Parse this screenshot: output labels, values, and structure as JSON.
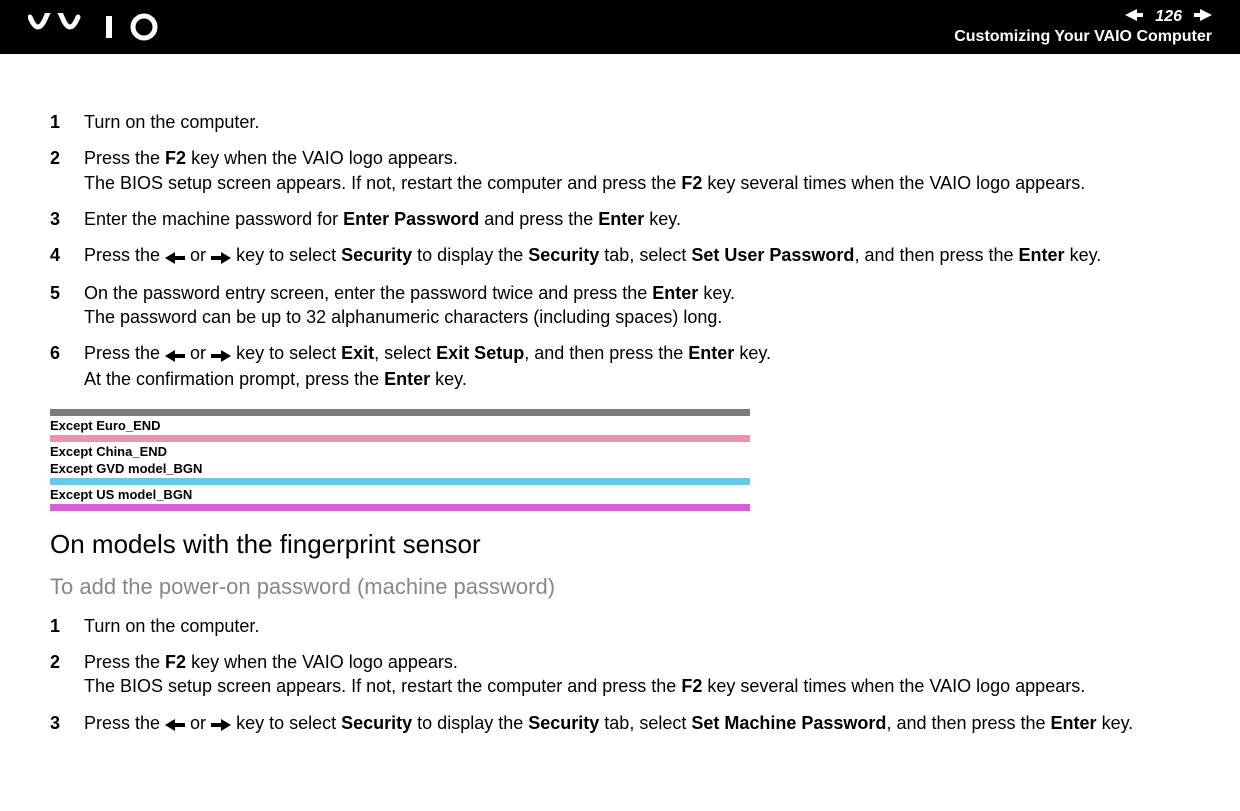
{
  "header": {
    "page_number": "126",
    "section_title": "Customizing Your VAIO Computer"
  },
  "list1": [
    {
      "num": "1",
      "segments": [
        {
          "t": "Turn on the computer."
        }
      ]
    },
    {
      "num": "2",
      "segments": [
        {
          "t": "Press the "
        },
        {
          "t": "F2",
          "b": true
        },
        {
          "t": " key when the VAIO logo appears."
        },
        {
          "t": "\n"
        },
        {
          "t": "The BIOS setup screen appears. If not, restart the computer and press the "
        },
        {
          "t": "F2",
          "b": true
        },
        {
          "t": " key several times when the VAIO logo appears."
        }
      ]
    },
    {
      "num": "3",
      "segments": [
        {
          "t": "Enter the machine password for "
        },
        {
          "t": "Enter Password",
          "b": true
        },
        {
          "t": " and press the "
        },
        {
          "t": "Enter",
          "b": true
        },
        {
          "t": " key."
        }
      ]
    },
    {
      "num": "4",
      "segments": [
        {
          "t": "Press the "
        },
        {
          "icon": "left"
        },
        {
          "t": " or "
        },
        {
          "icon": "right"
        },
        {
          "t": " key to select "
        },
        {
          "t": "Security",
          "b": true
        },
        {
          "t": " to display the "
        },
        {
          "t": "Security",
          "b": true
        },
        {
          "t": " tab, select "
        },
        {
          "t": "Set User Password",
          "b": true
        },
        {
          "t": ", and then press the "
        },
        {
          "t": "Enter",
          "b": true
        },
        {
          "t": " key."
        }
      ]
    },
    {
      "num": "5",
      "segments": [
        {
          "t": "On the password entry screen, enter the password twice and press the "
        },
        {
          "t": "Enter",
          "b": true
        },
        {
          "t": " key."
        },
        {
          "t": "\n"
        },
        {
          "t": "The password can be up to 32 alphanumeric characters (including spaces) long."
        }
      ]
    },
    {
      "num": "6",
      "segments": [
        {
          "t": "Press the "
        },
        {
          "icon": "left"
        },
        {
          "t": " or "
        },
        {
          "icon": "right"
        },
        {
          "t": " key to select "
        },
        {
          "t": "Exit",
          "b": true
        },
        {
          "t": ", select "
        },
        {
          "t": "Exit Setup",
          "b": true
        },
        {
          "t": ", and then press the "
        },
        {
          "t": "Enter",
          "b": true
        },
        {
          "t": " key."
        },
        {
          "t": "\n"
        },
        {
          "t": "At the confirmation prompt, press the "
        },
        {
          "t": "Enter",
          "b": true
        },
        {
          "t": " key."
        }
      ]
    }
  ],
  "markers": [
    {
      "color": "#7a7a7a",
      "label": "Except Euro_END"
    },
    {
      "color": "#f08fb1",
      "label": "Except China_END"
    },
    {
      "noBar": true,
      "label": "Except GVD model_BGN"
    },
    {
      "color": "#6bc6e8",
      "label": "Except US model_BGN"
    },
    {
      "color": "#d65fd6",
      "label": ""
    }
  ],
  "subheading": "On models with the fingerprint sensor",
  "subsubheading": "To add the power-on password (machine password)",
  "list2": [
    {
      "num": "1",
      "segments": [
        {
          "t": "Turn on the computer."
        }
      ]
    },
    {
      "num": "2",
      "segments": [
        {
          "t": "Press the "
        },
        {
          "t": "F2",
          "b": true
        },
        {
          "t": " key when the VAIO logo appears."
        },
        {
          "t": "\n"
        },
        {
          "t": "The BIOS setup screen appears. If not, restart the computer and press the "
        },
        {
          "t": "F2",
          "b": true
        },
        {
          "t": " key several times when the VAIO logo appears."
        }
      ]
    },
    {
      "num": "3",
      "segments": [
        {
          "t": "Press the "
        },
        {
          "icon": "left"
        },
        {
          "t": " or "
        },
        {
          "icon": "right"
        },
        {
          "t": " key to select "
        },
        {
          "t": "Security",
          "b": true
        },
        {
          "t": " to display the "
        },
        {
          "t": "Security",
          "b": true
        },
        {
          "t": " tab, select "
        },
        {
          "t": "Set Machine Password",
          "b": true
        },
        {
          "t": ", and then press the "
        },
        {
          "t": "Enter",
          "b": true
        },
        {
          "t": " key."
        }
      ]
    }
  ]
}
